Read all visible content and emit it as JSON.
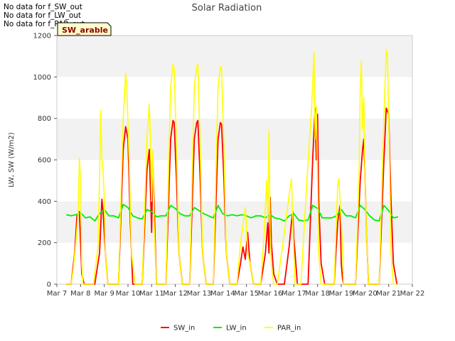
{
  "no_data_messages": [
    "No data for f_SW_out",
    "No data for f_LW_out",
    "No data for f_PAR_out"
  ],
  "site_label": "SW_arable",
  "chart_data": {
    "type": "line",
    "title": "Solar Radiation",
    "xlabel": "",
    "ylabel": "LW, SW (W/m2)",
    "ylim": [
      0,
      1200
    ],
    "yticks": [
      0,
      200,
      400,
      600,
      800,
      1000,
      1200
    ],
    "xlim": [
      7,
      22
    ],
    "xticks": [
      7,
      8,
      9,
      10,
      11,
      12,
      13,
      14,
      15,
      16,
      17,
      18,
      19,
      20,
      21,
      22
    ],
    "xtick_labels": [
      "Mar 7",
      "Mar 8",
      "Mar 9",
      "Mar 10",
      "Mar 11",
      "Mar 12",
      "Mar 13",
      "Mar 14",
      "Mar 15",
      "Mar 16",
      "Mar 17",
      "Mar 18",
      "Mar 19",
      "Mar 20",
      "Mar 21",
      "Mar 22"
    ],
    "grid": "horizontal bands",
    "legend_position": "bottom-center",
    "colors": {
      "SW_in": "#ff0000",
      "LW_in": "#00ee00",
      "PAR_in": "#ffff00",
      "band": "#f2f2f2"
    },
    "series": [
      {
        "name": "SW_in",
        "color": "#ff0000",
        "x": [
          7.4,
          7.6,
          7.75,
          7.85,
          7.95,
          8.05,
          8.15,
          8.25,
          8.6,
          8.8,
          8.9,
          8.95,
          9.05,
          9.15,
          9.35,
          9.6,
          9.8,
          9.9,
          10.0,
          10.1,
          10.2,
          10.35,
          10.6,
          10.8,
          10.9,
          11.0,
          11.05,
          11.1,
          11.2,
          11.3,
          11.6,
          11.8,
          11.9,
          11.95,
          12.05,
          12.15,
          12.3,
          12.6,
          12.8,
          12.9,
          12.95,
          13.05,
          13.15,
          13.3,
          13.6,
          13.8,
          13.9,
          13.95,
          14.05,
          14.15,
          14.3,
          14.6,
          14.75,
          14.85,
          14.95,
          15.05,
          15.15,
          15.3,
          15.6,
          15.8,
          15.9,
          15.95,
          16.0,
          16.05,
          16.15,
          16.3,
          16.6,
          16.8,
          16.9,
          16.95,
          17.0,
          17.05,
          17.15,
          17.3,
          17.6,
          17.8,
          17.9,
          17.95,
          18.0,
          18.05,
          18.15,
          18.3,
          18.7,
          18.85,
          18.95,
          19.0,
          19.05,
          19.1,
          19.3,
          19.6,
          19.8,
          19.9,
          19.95,
          20.0,
          20.05,
          20.15,
          20.3,
          20.6,
          20.8,
          20.9,
          21.0,
          21.05,
          21.1,
          21.2,
          21.35
        ],
        "y": [
          0,
          0,
          150,
          330,
          350,
          50,
          0,
          0,
          0,
          150,
          410,
          350,
          150,
          0,
          0,
          0,
          650,
          760,
          700,
          300,
          0,
          0,
          0,
          550,
          650,
          250,
          600,
          400,
          0,
          0,
          0,
          700,
          790,
          780,
          500,
          150,
          0,
          0,
          700,
          780,
          790,
          500,
          150,
          0,
          0,
          700,
          780,
          770,
          500,
          150,
          0,
          0,
          100,
          180,
          120,
          250,
          100,
          0,
          0,
          150,
          300,
          150,
          420,
          200,
          50,
          0,
          0,
          180,
          300,
          350,
          220,
          150,
          0,
          0,
          0,
          620,
          850,
          600,
          820,
          400,
          100,
          0,
          0,
          300,
          380,
          100,
          30,
          0,
          0,
          0,
          500,
          650,
          700,
          550,
          300,
          0,
          0,
          0,
          600,
          850,
          820,
          600,
          400,
          100,
          0
        ]
      },
      {
        "name": "LW_in",
        "color": "#00ee00",
        "x": [
          7.4,
          7.6,
          7.8,
          8.0,
          8.2,
          8.4,
          8.6,
          8.8,
          9.0,
          9.2,
          9.4,
          9.6,
          9.8,
          10.0,
          10.2,
          10.4,
          10.6,
          10.8,
          11.0,
          11.2,
          11.4,
          11.6,
          11.8,
          12.0,
          12.2,
          12.4,
          12.6,
          12.8,
          13.0,
          13.2,
          13.4,
          13.6,
          13.8,
          14.0,
          14.2,
          14.4,
          14.6,
          14.8,
          15.0,
          15.2,
          15.4,
          15.6,
          15.8,
          16.0,
          16.2,
          16.4,
          16.6,
          16.8,
          17.0,
          17.2,
          17.4,
          17.6,
          17.8,
          18.0,
          18.2,
          18.4,
          18.6,
          18.8,
          19.0,
          19.2,
          19.4,
          19.6,
          19.8,
          20.0,
          20.2,
          20.4,
          20.6,
          20.8,
          21.0,
          21.2,
          21.4
        ],
        "y": [
          335,
          330,
          335,
          345,
          320,
          325,
          305,
          340,
          360,
          330,
          330,
          320,
          385,
          370,
          330,
          320,
          315,
          360,
          350,
          325,
          330,
          330,
          380,
          365,
          340,
          330,
          330,
          370,
          355,
          340,
          330,
          320,
          380,
          340,
          330,
          335,
          330,
          335,
          330,
          320,
          330,
          330,
          320,
          335,
          320,
          315,
          305,
          330,
          340,
          310,
          305,
          310,
          380,
          365,
          320,
          320,
          320,
          330,
          360,
          330,
          330,
          320,
          380,
          360,
          330,
          310,
          305,
          380,
          355,
          320,
          325
        ]
      },
      {
        "name": "PAR_in",
        "color": "#ffff00",
        "x": [
          7.4,
          7.6,
          7.7,
          7.8,
          7.9,
          7.95,
          8.0,
          8.05,
          8.1,
          8.2,
          8.55,
          8.75,
          8.85,
          8.9,
          8.95,
          9.0,
          9.05,
          9.15,
          9.35,
          9.6,
          9.8,
          9.9,
          9.95,
          10.05,
          10.15,
          10.3,
          10.6,
          10.8,
          10.9,
          10.95,
          11.0,
          11.05,
          11.1,
          11.2,
          11.3,
          11.6,
          11.8,
          11.9,
          11.95,
          12.05,
          12.15,
          12.3,
          12.6,
          12.8,
          12.9,
          12.95,
          13.05,
          13.15,
          13.3,
          13.6,
          13.8,
          13.9,
          13.95,
          14.05,
          14.15,
          14.3,
          14.6,
          14.75,
          14.85,
          14.95,
          15.0,
          15.05,
          15.15,
          15.3,
          15.6,
          15.75,
          15.85,
          15.9,
          15.95,
          16.0,
          16.05,
          16.15,
          16.3,
          16.6,
          16.8,
          16.9,
          16.95,
          17.0,
          17.05,
          17.15,
          17.3,
          17.55,
          17.75,
          17.85,
          17.9,
          17.95,
          18.0,
          18.05,
          18.15,
          18.3,
          18.7,
          18.85,
          18.9,
          18.95,
          19.0,
          19.05,
          19.1,
          19.3,
          19.6,
          19.75,
          19.8,
          19.85,
          19.9,
          19.95,
          20.0,
          20.05,
          20.15,
          20.3,
          20.6,
          20.8,
          20.9,
          20.95,
          21.0,
          21.05,
          21.1,
          21.2,
          21.35
        ],
        "y": [
          0,
          0,
          80,
          200,
          350,
          610,
          500,
          100,
          0,
          0,
          0,
          200,
          840,
          600,
          550,
          410,
          150,
          0,
          0,
          0,
          800,
          1020,
          950,
          600,
          150,
          0,
          0,
          700,
          870,
          700,
          400,
          650,
          300,
          0,
          0,
          0,
          950,
          1060,
          1040,
          650,
          150,
          0,
          0,
          950,
          1050,
          1060,
          650,
          150,
          0,
          0,
          950,
          1050,
          1040,
          650,
          150,
          0,
          0,
          200,
          280,
          370,
          280,
          150,
          100,
          0,
          0,
          250,
          500,
          300,
          740,
          250,
          100,
          0,
          0,
          250,
          430,
          510,
          300,
          150,
          0,
          0,
          0,
          500,
          850,
          1120,
          700,
          860,
          500,
          150,
          0,
          0,
          0,
          480,
          510,
          400,
          300,
          180,
          0,
          0,
          0,
          500,
          950,
          1080,
          750,
          900,
          550,
          300,
          0,
          0,
          0,
          800,
          1130,
          1100,
          800,
          500,
          150,
          0,
          0
        ]
      }
    ]
  },
  "legend": {
    "items": [
      {
        "label": "SW_in",
        "color": "#ff0000"
      },
      {
        "label": "LW_in",
        "color": "#00ee00"
      },
      {
        "label": "PAR_in",
        "color": "#ffff00"
      }
    ]
  }
}
